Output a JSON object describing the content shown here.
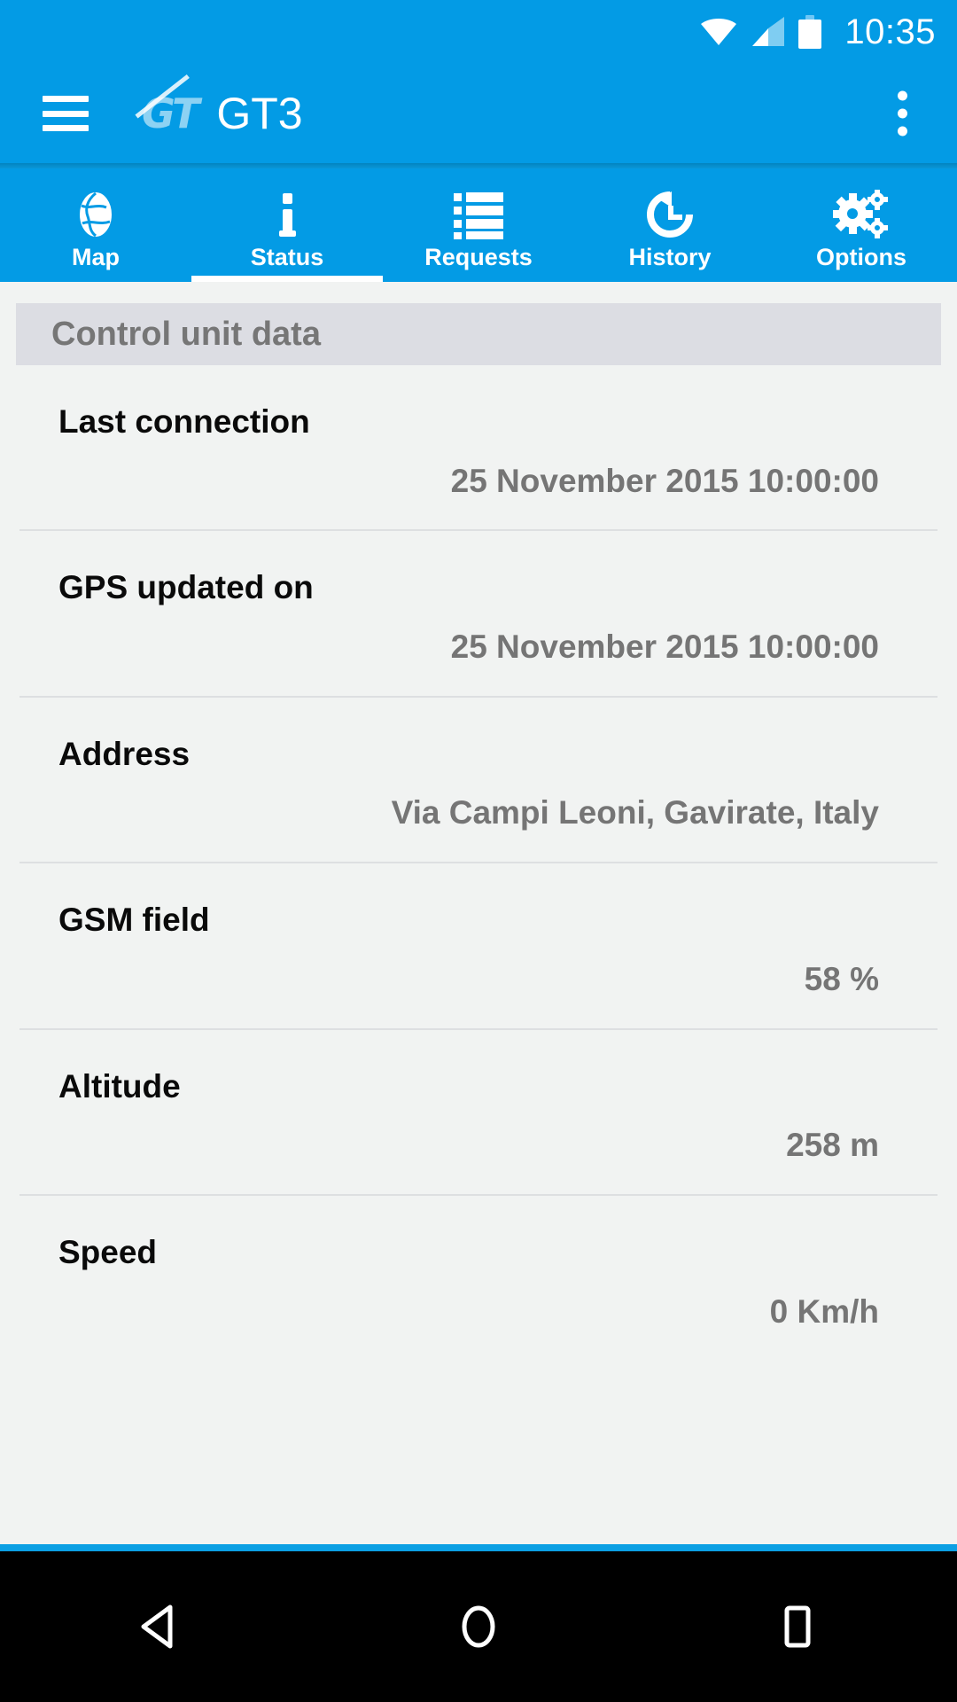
{
  "status_bar": {
    "time": "10:35",
    "icons": [
      "wifi-icon",
      "cellular-signal-icon",
      "battery-icon"
    ]
  },
  "action_bar": {
    "menu_icon": "hamburger-menu-icon",
    "logo_text": "GT",
    "title": "GT3",
    "overflow_icon": "overflow-menu-icon"
  },
  "tabs": [
    {
      "label": "Map",
      "icon": "globe-icon",
      "active": false
    },
    {
      "label": "Status",
      "icon": "info-icon",
      "active": true
    },
    {
      "label": "Requests",
      "icon": "list-icon",
      "active": false
    },
    {
      "label": "History",
      "icon": "history-icon",
      "active": false
    },
    {
      "label": "Options",
      "icon": "gears-icon",
      "active": false
    }
  ],
  "section": {
    "title": "Control unit data"
  },
  "rows": [
    {
      "label": "Last connection",
      "value": "25 November 2015 10:00:00"
    },
    {
      "label": "GPS updated on",
      "value": "25 November 2015 10:00:00"
    },
    {
      "label": "Address",
      "value": "Via Campi Leoni, Gavirate, Italy"
    },
    {
      "label": "GSM field",
      "value": "58 %"
    },
    {
      "label": "Altitude",
      "value": "258 m"
    },
    {
      "label": "Speed",
      "value": "0 Km/h"
    }
  ],
  "nav_bar": {
    "back": "back-triangle-icon",
    "home": "home-circle-icon",
    "recents": "recents-square-icon"
  },
  "colors": {
    "primary": "#039be5",
    "section_header_bg": "#dcdde3",
    "content_bg": "#f1f3f2",
    "value_text": "#757575",
    "label_text": "#0a0a0a"
  }
}
